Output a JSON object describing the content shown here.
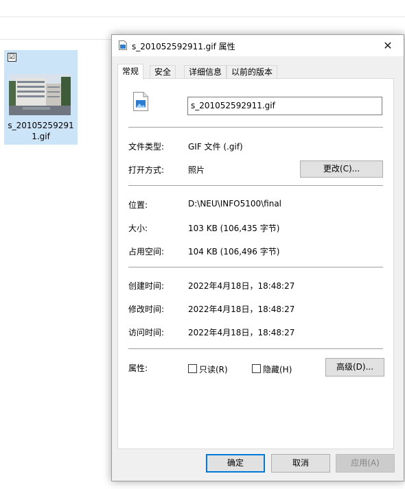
{
  "explorer": {
    "file_label": "s_201052592911.gif",
    "tile_checkbox": "☑"
  },
  "dialog": {
    "title": "s_201052592911.gif 属性",
    "close_glyph": "✕",
    "tabs": [
      {
        "label": "常规",
        "active": true
      },
      {
        "label": "安全"
      },
      {
        "label": "详细信息"
      },
      {
        "label": "以前的版本"
      }
    ],
    "file_name_value": "s_201052592911.gif",
    "file_type_label": "文件类型:",
    "file_type_value": "GIF 文件 (.gif)",
    "open_with_label": "打开方式:",
    "open_with_value": "照片",
    "change_button": "更改(C)...",
    "location_label": "位置:",
    "location_value": "D:\\NEU\\INFO5100\\final",
    "size_label": "大小:",
    "size_value": "103 KB (106,435 字节)",
    "size_on_disk_label": "占用空间:",
    "size_on_disk_value": "104 KB (106,496 字节)",
    "created_label": "创建时间:",
    "created_value": "2022年4月18日，18:48:27",
    "modified_label": "修改时间:",
    "modified_value": "2022年4月18日，18:48:27",
    "accessed_label": "访问时间:",
    "accessed_value": "2022年4月18日，18:48:27",
    "attributes_label": "属性:",
    "readonly_label": "只读(R)",
    "hidden_label": "隐藏(H)",
    "advanced_button": "高级(D)...",
    "ok_button": "确定",
    "cancel_button": "取消",
    "apply_button": "应用(A)"
  },
  "colors": {
    "selection": "#cce4f7",
    "accent": "#0078d7",
    "dialog_bg": "#f0f0f0"
  }
}
